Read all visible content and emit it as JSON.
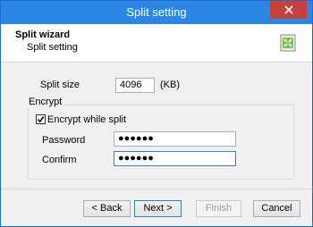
{
  "window": {
    "title": "Split setting"
  },
  "header": {
    "title": "Split wizard",
    "subtitle": "Split setting"
  },
  "split": {
    "label": "Split size",
    "value": "4096",
    "unit": "(KB)"
  },
  "encrypt": {
    "group_label": "Encrypt",
    "checkbox_label": "Encrypt while split",
    "checked": true,
    "password_label": "Password",
    "password_value": "●●●●●●",
    "confirm_label": "Confirm",
    "confirm_value": "●●●●●●"
  },
  "buttons": {
    "back": "< Back",
    "next": "Next >",
    "finish": "Finish",
    "cancel": "Cancel"
  },
  "colors": {
    "titlebar": "#2b87e3",
    "close": "#c7413c",
    "focus": "#3c7fb1"
  },
  "icons": {
    "close": "close-icon",
    "wizard": "wizard-icon",
    "check": "checkmark-icon"
  }
}
